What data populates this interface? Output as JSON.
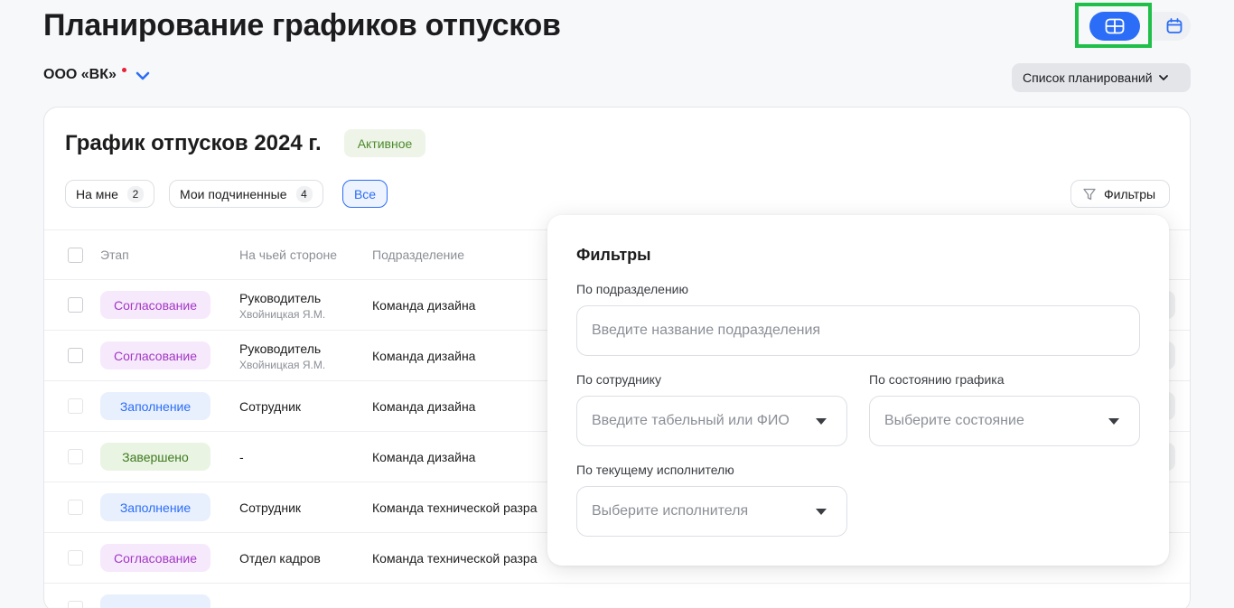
{
  "page": {
    "title": "Планирование графиков отпусков",
    "organization": "ООО «ВК»",
    "plan_list_label": "Список планирований"
  },
  "view_toggle": {
    "active": "table",
    "options": [
      "table-icon",
      "calendar-icon"
    ],
    "accent_color": "#2b6df6",
    "highlight_color": "#1fbf4a"
  },
  "card": {
    "title": "График отпусков 2024 г.",
    "status": "Активное",
    "tabs": [
      {
        "label": "На мне",
        "count": "2"
      },
      {
        "label": "Мои подчиненные",
        "count": "4"
      },
      {
        "label": "Все"
      }
    ],
    "active_tab": "Все",
    "filters_label": "Фильтры"
  },
  "table": {
    "columns": [
      "Этап",
      "На чьей стороне",
      "Подразделение"
    ],
    "rows": [
      {
        "stage": "Согласование",
        "stage_color": "purple",
        "side": "Руководитель",
        "side_sub": "Хвойницкая Я.М.",
        "dept": "Команда дизайна"
      },
      {
        "stage": "Согласование",
        "stage_color": "purple",
        "side": "Руководитель",
        "side_sub": "Хвойницкая Я.М.",
        "dept": "Команда дизайна"
      },
      {
        "stage": "Заполнение",
        "stage_color": "blue",
        "side": "Сотрудник",
        "side_sub": "",
        "dept": "Команда дизайна"
      },
      {
        "stage": "Завершено",
        "stage_color": "green",
        "side": "-",
        "side_sub": "",
        "dept": "Команда дизайна"
      },
      {
        "stage": "Заполнение",
        "stage_color": "blue",
        "side": "Сотрудник",
        "side_sub": "",
        "dept": "Команда технической разра"
      },
      {
        "stage": "Согласование",
        "stage_color": "purple",
        "side": "Отдел кадров",
        "side_sub": "",
        "dept": "Команда технической разра"
      }
    ]
  },
  "filters_popup": {
    "title": "Фильтры",
    "department_label": "По подразделению",
    "department_placeholder": "Введите название подразделения",
    "employee_label": "По сотруднику",
    "employee_placeholder": "Введите табельный или ФИО",
    "state_label": "По состоянию графика",
    "state_placeholder": "Выберите состояние",
    "executor_label": "По текущему исполнителю",
    "executor_placeholder": "Выберите исполнителя"
  }
}
